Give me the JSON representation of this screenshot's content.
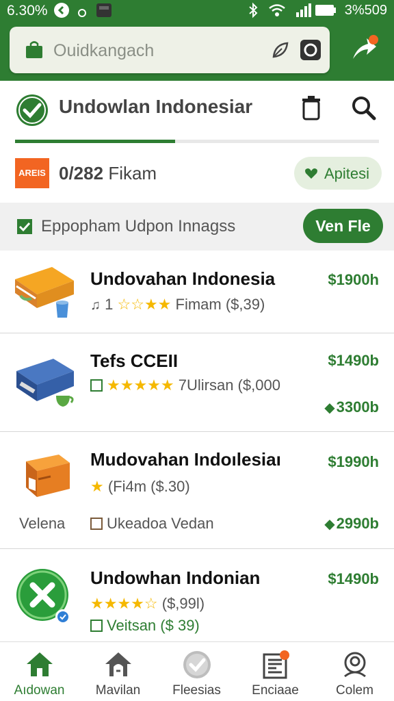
{
  "status": {
    "time": "6.30%",
    "battery": "3%509"
  },
  "search": {
    "placeholder": "Ouidkangach"
  },
  "header": {
    "title": "Undowlan Indonesiar",
    "progress": 0.44
  },
  "summary": {
    "badge": "AREIS",
    "count": "0/282",
    "count_unit": "Fikam",
    "chip_label": "Apitesi"
  },
  "filter": {
    "label": "Eppopham Udpon Innagss",
    "button": "Ven Fle"
  },
  "products": [
    {
      "name": "Undovahan Indonesia",
      "meta_prefix": "1",
      "stars": "☆☆★★",
      "meta": "Fimam ($,39)",
      "price": "$1900h"
    },
    {
      "name": "Tefs CCEII",
      "stars": "★★★★★",
      "meta": "7Ulirsan ($,000",
      "price": "$1490b",
      "price2": "3300b"
    },
    {
      "name": "Mudovahan Indoılesiaı",
      "stars": "★",
      "meta": "(Fi4m ($.30)",
      "price": "$1990h",
      "left_label": "Velena",
      "sub": "Ukeadoa Vedan",
      "price2": "2990b"
    },
    {
      "name": "Undowhan Indonian",
      "stars": "★★★★☆",
      "meta": "($,99l)",
      "price": "$1490b",
      "sub": "Veitsan ($ 39)"
    }
  ],
  "nav": [
    {
      "label": "Aıdowan",
      "icon": "home-icon"
    },
    {
      "label": "Mavilan",
      "icon": "house-icon"
    },
    {
      "label": "Fleesias",
      "icon": "check-circle-icon"
    },
    {
      "label": "Enciaae",
      "icon": "newspaper-icon"
    },
    {
      "label": "Colem",
      "icon": "profile-icon"
    }
  ],
  "colors": {
    "primary": "#2e7d32",
    "accent": "#f26522"
  }
}
